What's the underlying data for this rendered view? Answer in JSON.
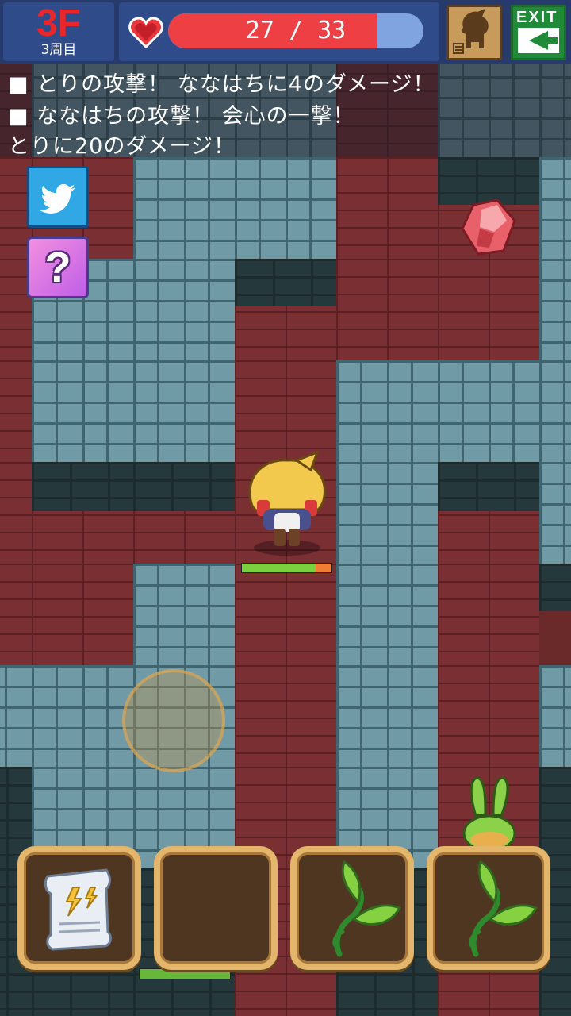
{
  "hud": {
    "floor": "3F",
    "lap": "3周目",
    "hp_current": 27,
    "hp_max": 33,
    "hp_text": "27 / 33",
    "hp_fraction": 0.818,
    "exit_label": "EXIT"
  },
  "log": {
    "lines": [
      "■ とりの攻撃！ ななはちに4のダメージ！",
      "■ ななはちの攻撃！ 会心の一撃！",
      "とりに20のダメージ！"
    ]
  },
  "side_buttons": {
    "twitter_icon": "twitter-bird-icon",
    "help_label": "?"
  },
  "items": [
    {
      "icon": "magic-scroll-icon",
      "empty": false
    },
    {
      "icon": "",
      "empty": true
    },
    {
      "icon": "herb-leaf-icon",
      "empty": false
    },
    {
      "icon": "herb-leaf-icon",
      "empty": false
    }
  ],
  "hero": {
    "hp_fraction": 0.82
  },
  "colors": {
    "hp_fill": "#ee3f45",
    "hp_empty": "#7fa4e0",
    "floor_text": "#e8262b",
    "slot_border": "#e3b66c"
  }
}
